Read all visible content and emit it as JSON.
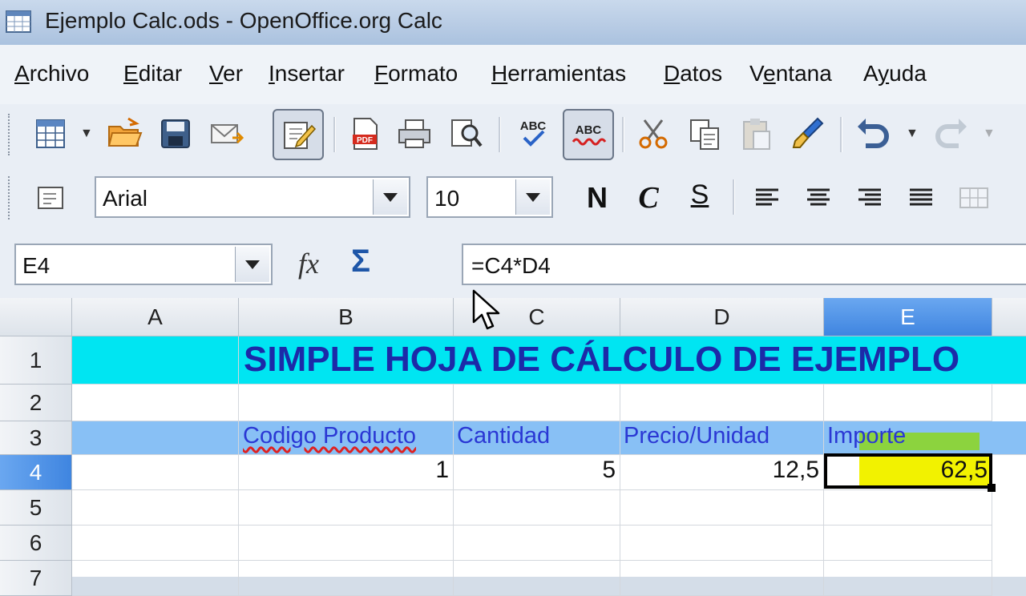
{
  "window": {
    "title": "Ejemplo Calc.ods - OpenOffice.org Calc"
  },
  "menu": [
    {
      "label": "Archivo",
      "accel": "A"
    },
    {
      "label": "Editar",
      "accel": "E"
    },
    {
      "label": "Ver",
      "accel": "V"
    },
    {
      "label": "Insertar",
      "accel": "I"
    },
    {
      "label": "Formato",
      "accel": "F"
    },
    {
      "label": "Herramientas",
      "accel": "H"
    },
    {
      "label": "Datos",
      "accel": "D"
    },
    {
      "label": "Ventana",
      "accel": "e"
    },
    {
      "label": "Ayuda",
      "accel": "y"
    }
  ],
  "toolbar": {
    "abc_label_1": "ABC",
    "abc_label_2": "ABC"
  },
  "format": {
    "font_name": "Arial",
    "font_size": "10",
    "bold": "N",
    "italic": "C",
    "underline": "S"
  },
  "formula_bar": {
    "cell_ref": "E4",
    "fx": "fx",
    "sum": "Σ",
    "formula": "=C4*D4"
  },
  "sheet": {
    "columns": [
      "A",
      "B",
      "C",
      "D",
      "E"
    ],
    "selected_column": "E",
    "rows": [
      "1",
      "2",
      "3",
      "4",
      "5",
      "6",
      "7"
    ],
    "selected_row": "4",
    "title": "SIMPLE HOJA DE CÁLCULO DE EJEMPLO",
    "headers": {
      "b": "Codigo Producto",
      "c": "Cantidad",
      "d": "Precio/Unidad",
      "e": "Importe"
    },
    "row4": {
      "b": "1",
      "c": "5",
      "d": "12,5",
      "e": "62,5"
    }
  },
  "colors": {
    "title_row_bg": "#00e5f2",
    "header_row_bg": "#88c0f5",
    "title_text": "#1c2aa8",
    "header_text": "#2a37d4",
    "selection_header": "#3f85e0",
    "highlight_yellow": "#f2f200",
    "highlight_green": "#8cd33e"
  }
}
